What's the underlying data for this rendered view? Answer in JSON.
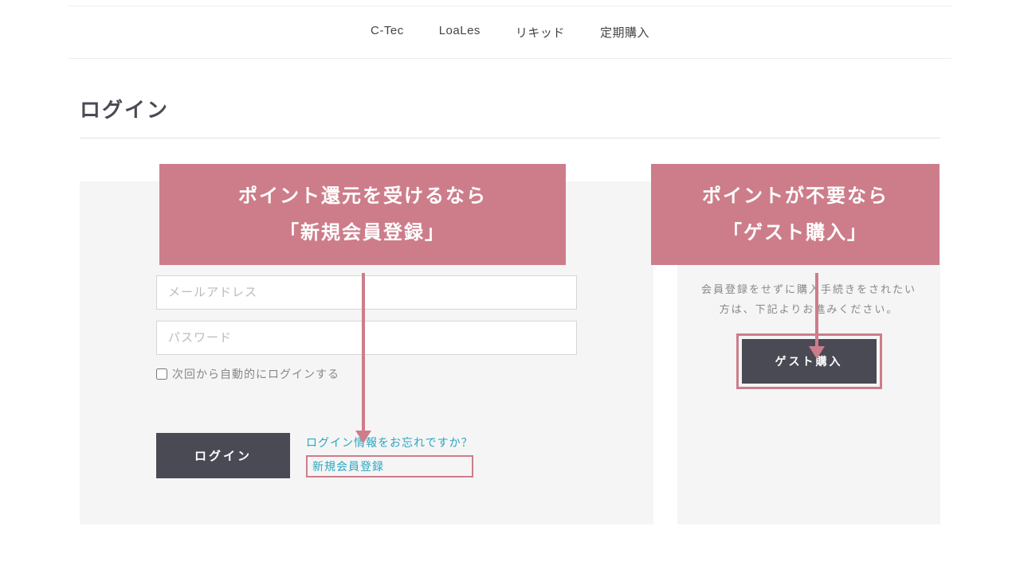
{
  "nav": {
    "items": [
      "C-Tec",
      "LoaLes",
      "リキッド",
      "定期購入"
    ]
  },
  "title": "ログイン",
  "callout_left": {
    "line1": "ポイント還元を受けるなら",
    "line2": "「新規会員登録」"
  },
  "callout_right": {
    "line1": "ポイントが不要なら",
    "line2": "「ゲスト購入」"
  },
  "login": {
    "email_placeholder": "メールアドレス",
    "password_placeholder": "パスワード",
    "remember_label": "次回から自動的にログインする",
    "button_label": "ログイン",
    "forgot_link": "ログイン情報をお忘れですか？",
    "signup_link": "新規会員登録"
  },
  "guest": {
    "text": "会員登録をせずに購入手続きをされたい方は、下記よりお進みください。",
    "button_label": "ゲスト購入"
  }
}
